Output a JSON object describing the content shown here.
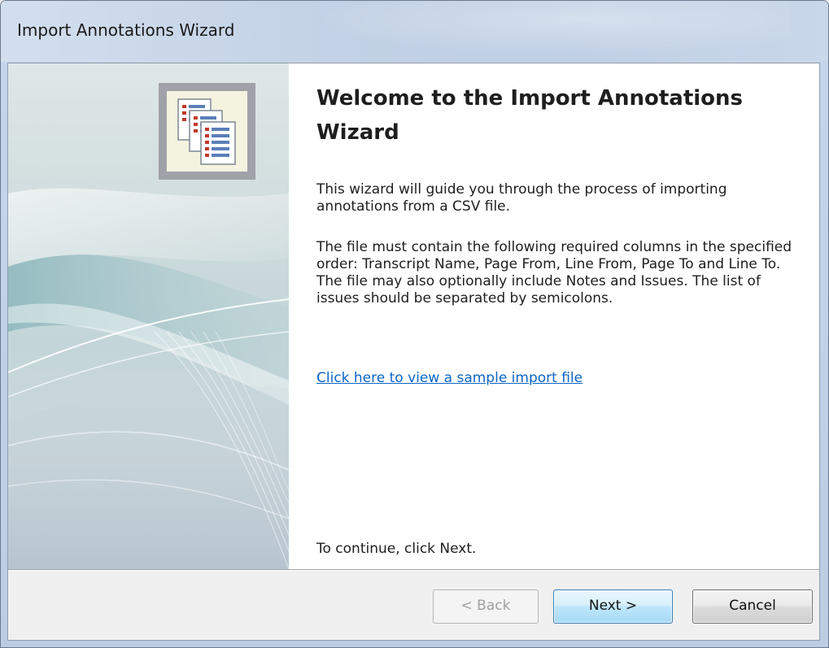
{
  "window": {
    "title": "Import Annotations Wizard"
  },
  "banner": {
    "icon": "documents-stack-icon"
  },
  "content": {
    "heading": "Welcome to the Import Annotations Wizard",
    "intro": "This wizard will guide you through the process of importing annotations from a CSV file.",
    "details": "The file must contain the following required columns in the specified order: Transcript Name, Page From, Line From, Page To and Line To.  The file may also optionally include Notes and Issues.  The list of issues should be separated by semicolons.",
    "sample_link": "Click here to view a sample import file",
    "continue_hint": "To continue, click Next."
  },
  "buttons": {
    "back": {
      "label": "< Back",
      "enabled": false
    },
    "next": {
      "label": "Next >",
      "enabled": true,
      "default": true
    },
    "cancel": {
      "label": "Cancel",
      "enabled": true
    }
  },
  "colors": {
    "link": "#0b65c5",
    "default_button_border": "#3c7fb1"
  }
}
